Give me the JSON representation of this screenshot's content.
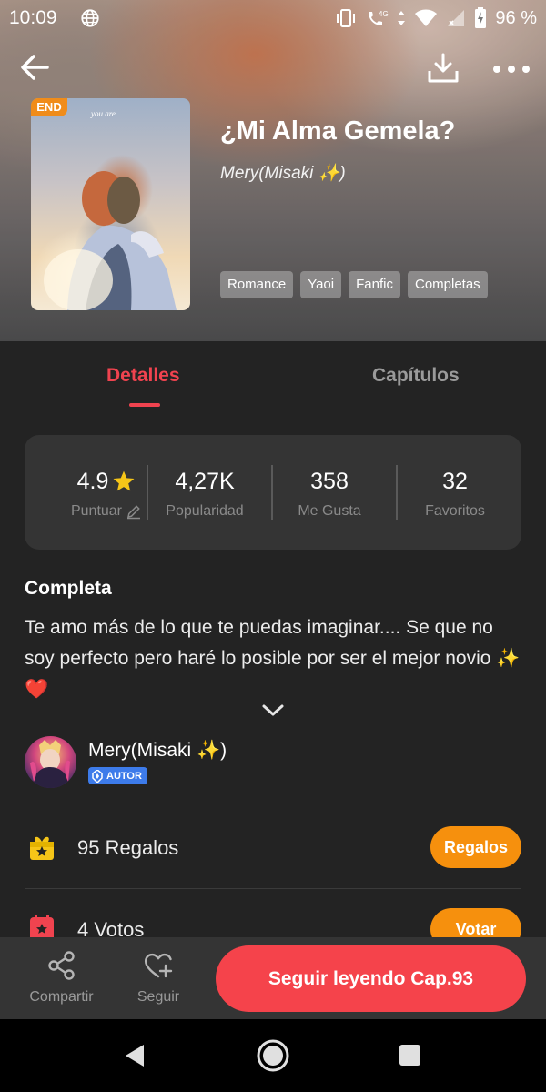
{
  "status_bar": {
    "time": "10:09",
    "network": "4G",
    "battery": "96 %"
  },
  "book": {
    "badge": "END",
    "cover_script": "you are",
    "title": "¿Mi Alma Gemela?",
    "author": "Mery(Misaki ✨)",
    "tags": [
      "Romance",
      "Yaoi",
      "Fanfic",
      "Completas"
    ]
  },
  "tabs": {
    "details": "Detalles",
    "chapters": "Capítulos",
    "active": "details"
  },
  "stats": [
    {
      "value": "4.9",
      "label": "Puntuar"
    },
    {
      "value": "4,27K",
      "label": "Popularidad"
    },
    {
      "value": "358",
      "label": "Me Gusta"
    },
    {
      "value": "32",
      "label": "Favoritos"
    }
  ],
  "details": {
    "status": "Completa",
    "description": "Te amo más de lo que te puedas imaginar.... Se que no soy perfecto pero haré lo posible por ser el mejor novio ✨❤️"
  },
  "author": {
    "name": "Mery(Misaki ✨)",
    "badge": "AUTOR"
  },
  "gifts": {
    "count_text": "95 Regalos",
    "button": "Regalos"
  },
  "votes": {
    "count_text": "4 Votos",
    "button": "Votar"
  },
  "bottom_bar": {
    "share": "Compartir",
    "follow": "Seguir",
    "continue": "Seguir leyendo Cap.93"
  },
  "colors": {
    "accent": "#f0434f",
    "orange": "#f6900d",
    "background": "#232323",
    "card": "#343434",
    "star": "#f5c518"
  },
  "icons": [
    "globe-icon",
    "vibrate-icon",
    "wifi-calling-icon",
    "wifi-icon",
    "signal-icon",
    "battery-icon",
    "back-arrow-icon",
    "download-icon",
    "more-icon",
    "star-icon",
    "edit-icon",
    "chevron-down-icon",
    "gift-icon",
    "calendar-icon",
    "share-icon",
    "heart-plus-icon",
    "nav-back-icon",
    "nav-home-icon",
    "nav-recents-icon"
  ]
}
